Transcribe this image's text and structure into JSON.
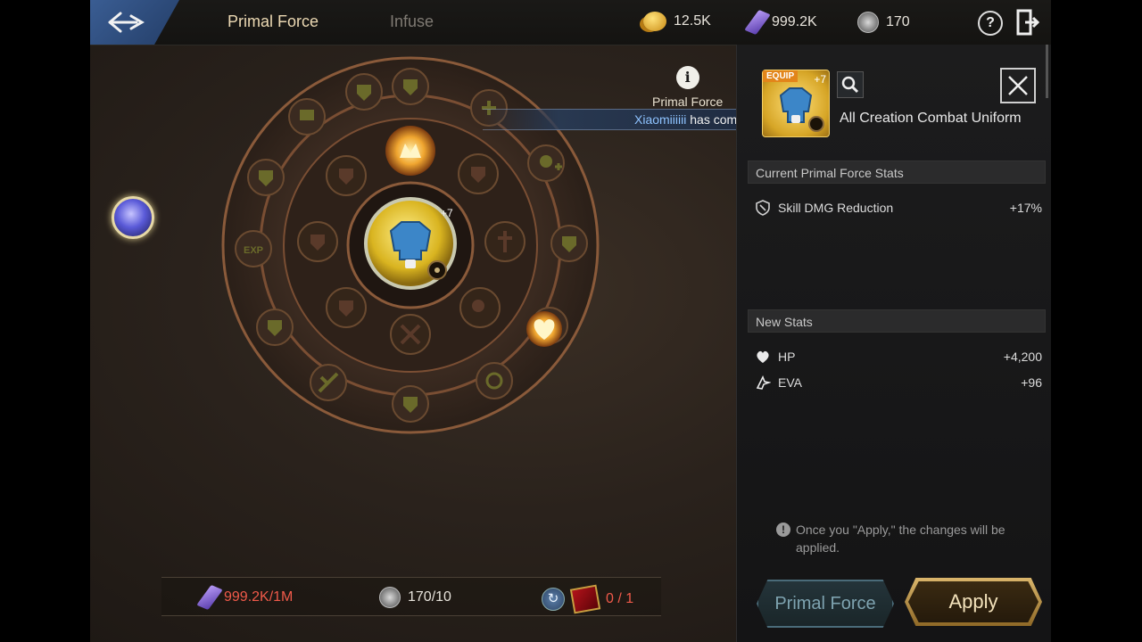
{
  "header": {
    "tabs": [
      {
        "label": "Primal Force",
        "active": true
      },
      {
        "label": "Infuse",
        "active": false
      }
    ],
    "currencies": [
      {
        "icon": "gold-coin-icon",
        "value": "12.5K"
      },
      {
        "icon": "purple-crystal-icon",
        "value": "999.2K"
      },
      {
        "icon": "silver-stone-icon",
        "value": "170"
      }
    ],
    "help_label": "?"
  },
  "wheel": {
    "center_item_level": "+7",
    "info_label": "Primal Force"
  },
  "ticker": {
    "name": "Xiaomiiiiii",
    "message": " has combined"
  },
  "bottom_bar": {
    "crystal_cost": "999.2K/1M",
    "silver_cost": "170/10",
    "book_cost": "0 / 1"
  },
  "panel": {
    "equip_tag": "EQUIP",
    "item_level": "+7",
    "item_name": "All Creation Combat Uniform",
    "current_header": "Current Primal Force Stats",
    "current_stats": [
      {
        "icon": "shield-icon",
        "name": "Skill DMG Reduction",
        "value": "+17%"
      }
    ],
    "new_header": "New Stats",
    "new_stats": [
      {
        "icon": "heart-icon",
        "name": "HP",
        "value": "+4,200"
      },
      {
        "icon": "evasion-icon",
        "name": "EVA",
        "value": "+96"
      }
    ],
    "notice": "Once you \"Apply,\" the changes will be applied.",
    "primal_force_button": "Primal Force",
    "apply_button": "Apply"
  },
  "colors": {
    "accent_gold": "#e8b33a",
    "cost_red": "#f05a4a",
    "ticker_name": "#8ec3ff"
  }
}
